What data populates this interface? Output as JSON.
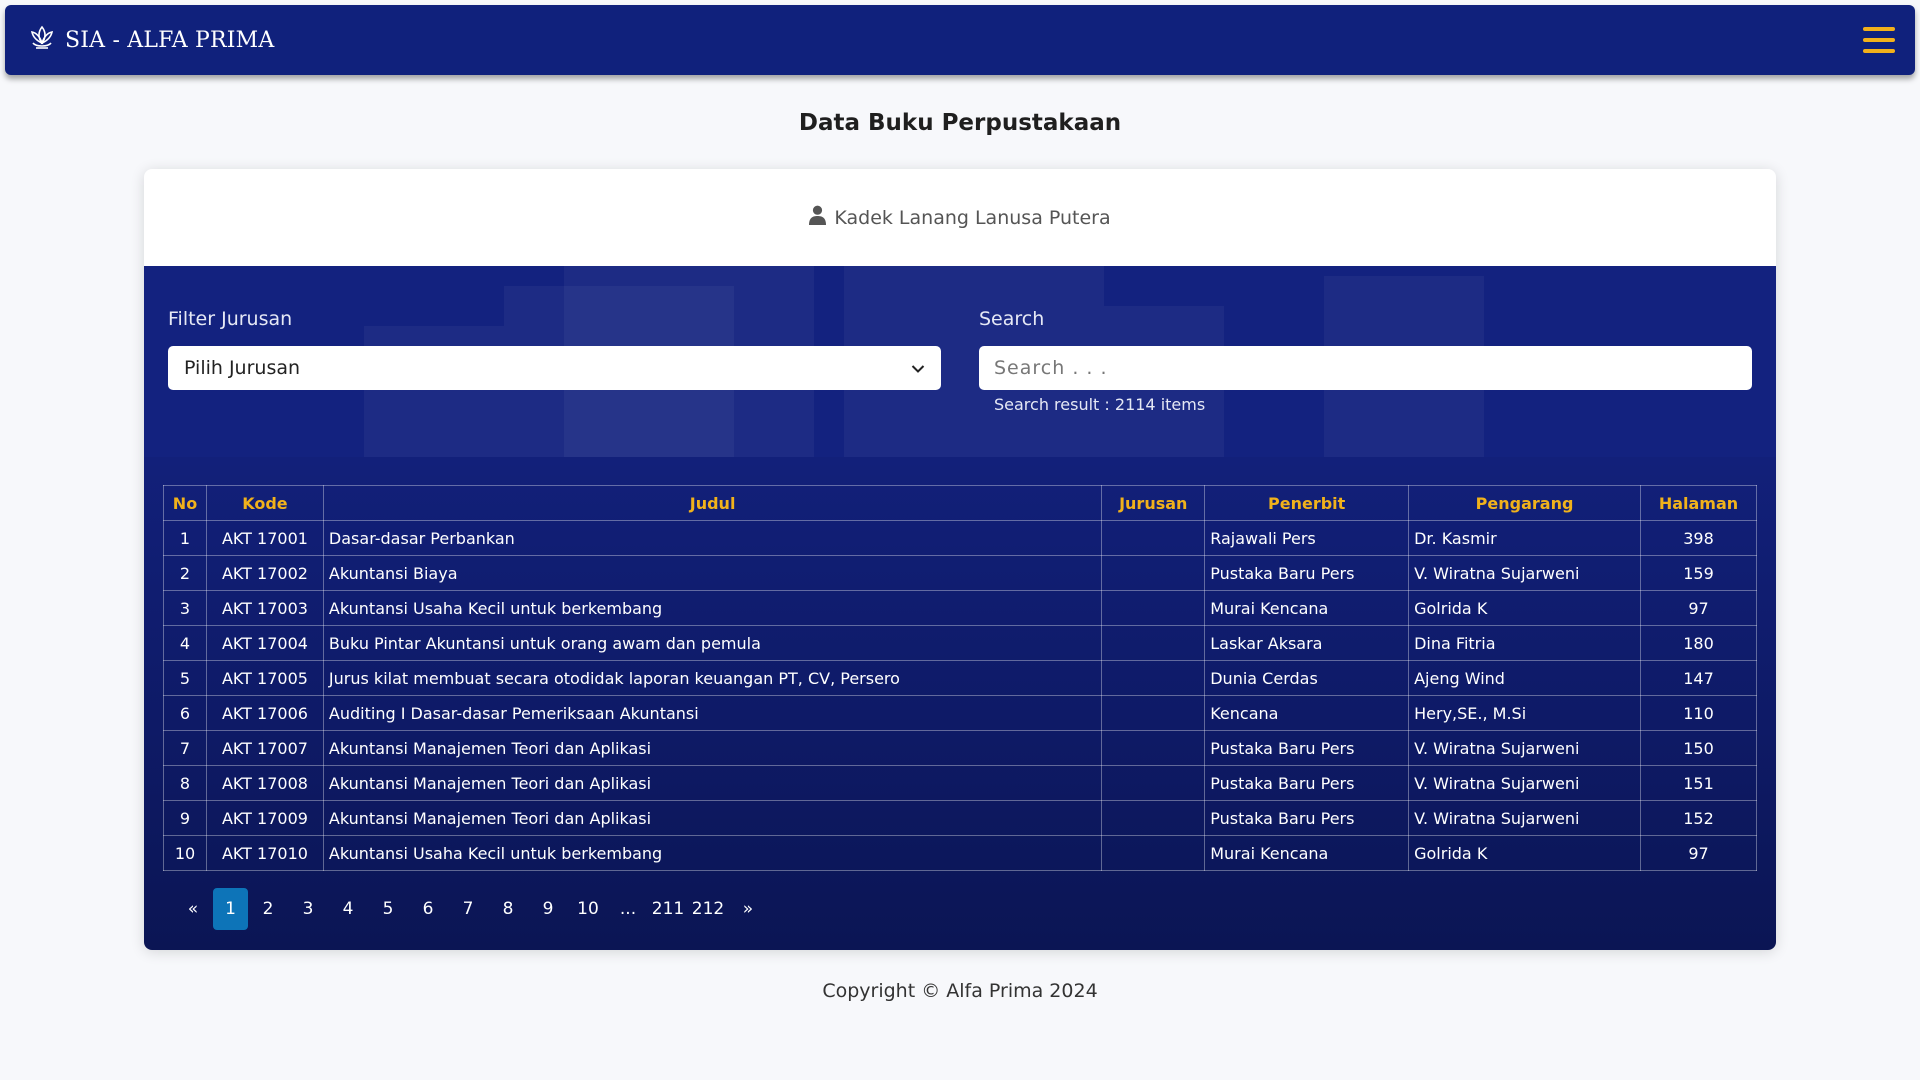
{
  "app": {
    "brand": "SIA - ALFA PRIMA",
    "logo_icon": "lotus-logo-icon",
    "menu_icon": "hamburger-menu-icon",
    "accent": "#f3b11a",
    "navbar_color": "#10217c"
  },
  "page": {
    "title": "Data Buku Perpustakaan"
  },
  "user": {
    "name": "Kadek Lanang Lanusa Putera",
    "icon": "user-icon"
  },
  "filters": {
    "jurusan_label": "Filter Jurusan",
    "jurusan_selected": "Pilih Jurusan",
    "search_label": "Search",
    "search_placeholder": "Search . . .",
    "search_value": "",
    "search_result": "Search result : 2114 items"
  },
  "table": {
    "headers": [
      "No",
      "Kode",
      "Judul",
      "Jurusan",
      "Penerbit",
      "Pengarang",
      "Halaman"
    ],
    "rows": [
      [
        "1",
        "AKT 17001",
        "Dasar-dasar Perbankan",
        "",
        "Rajawali Pers",
        "Dr. Kasmir",
        "398"
      ],
      [
        "2",
        "AKT 17002",
        "Akuntansi Biaya",
        "",
        "Pustaka Baru Pers",
        "V. Wiratna Sujarweni",
        "159"
      ],
      [
        "3",
        "AKT 17003",
        "Akuntansi Usaha Kecil untuk berkembang",
        "",
        "Murai Kencana",
        "Golrida K",
        "97"
      ],
      [
        "4",
        "AKT 17004",
        "Buku Pintar Akuntansi untuk orang awam dan pemula",
        "",
        "Laskar Aksara",
        "Dina Fitria",
        "180"
      ],
      [
        "5",
        "AKT 17005",
        "Jurus kilat membuat secara otodidak laporan keuangan PT, CV, Persero",
        "",
        "Dunia Cerdas",
        "Ajeng Wind",
        "147"
      ],
      [
        "6",
        "AKT 17006",
        "Auditing I Dasar-dasar Pemeriksaan Akuntansi",
        "",
        "Kencana",
        "Hery,SE., M.Si",
        "110"
      ],
      [
        "7",
        "AKT 17007",
        "Akuntansi Manajemen Teori dan Aplikasi",
        "",
        "Pustaka Baru Pers",
        "V. Wiratna Sujarweni",
        "150"
      ],
      [
        "8",
        "AKT 17008",
        "Akuntansi Manajemen Teori dan Aplikasi",
        "",
        "Pustaka Baru Pers",
        "V. Wiratna Sujarweni",
        "151"
      ],
      [
        "9",
        "AKT 17009",
        "Akuntansi Manajemen Teori dan Aplikasi",
        "",
        "Pustaka Baru Pers",
        "V. Wiratna Sujarweni",
        "152"
      ],
      [
        "10",
        "AKT 17010",
        "Akuntansi Usaha Kecil untuk berkembang",
        "",
        "Murai Kencana",
        "Golrida K",
        "97"
      ]
    ]
  },
  "pagination": {
    "prev": "«",
    "next": "»",
    "current": "1",
    "pages": [
      "1",
      "2",
      "3",
      "4",
      "5",
      "6",
      "7",
      "8",
      "9",
      "10",
      "...",
      "211",
      "212"
    ]
  },
  "footer": {
    "copyright": "Copyright © Alfa Prima 2024"
  }
}
